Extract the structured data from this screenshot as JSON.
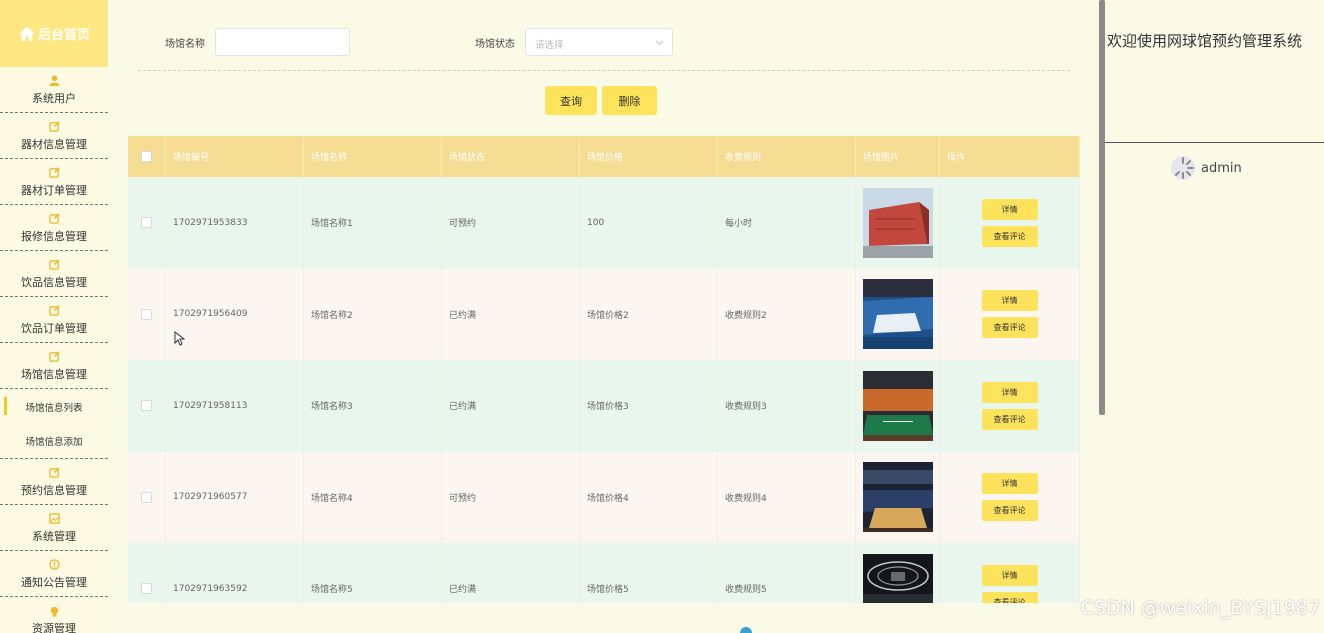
{
  "sidebar": {
    "home_label": "后台首页",
    "items": [
      {
        "label": "系统用户",
        "icon": "user-icon"
      },
      {
        "label": "器材信息管理",
        "icon": "edit-icon"
      },
      {
        "label": "器材订单管理",
        "icon": "edit-icon"
      },
      {
        "label": "报修信息管理",
        "icon": "edit-icon"
      },
      {
        "label": "饮品信息管理",
        "icon": "edit-icon"
      },
      {
        "label": "饮品订单管理",
        "icon": "edit-icon"
      },
      {
        "label": "场馆信息管理",
        "icon": "edit-icon"
      }
    ],
    "sub_items": [
      {
        "label": "场馆信息列表",
        "active": true
      },
      {
        "label": "场馆信息添加",
        "active": false
      }
    ],
    "items_after": [
      {
        "label": "预约信息管理",
        "icon": "edit-icon"
      },
      {
        "label": "系统管理",
        "icon": "picture-icon"
      },
      {
        "label": "通知公告管理",
        "icon": "alert-icon"
      },
      {
        "label": "资源管理",
        "icon": "bulb-icon"
      }
    ]
  },
  "search": {
    "name_label": "场馆名称",
    "name_value": "",
    "status_label": "场馆状态",
    "status_placeholder": "请选择",
    "query_button": "查询",
    "delete_button": "删除"
  },
  "table": {
    "headers": [
      "场馆编号",
      "场馆名称",
      "场馆状态",
      "场馆价格",
      "收费规则",
      "场馆图片",
      "操作"
    ],
    "rows": [
      {
        "id": "1702971953833",
        "name": "场馆名称1",
        "status": "可预约",
        "price": "100",
        "rule": "每小时"
      },
      {
        "id": "1702971956409",
        "name": "场馆名称2",
        "status": "已约满",
        "price": "场馆价格2",
        "rule": "收费规则2"
      },
      {
        "id": "1702971958113",
        "name": "场馆名称3",
        "status": "已约满",
        "price": "场馆价格3",
        "rule": "收费规则3"
      },
      {
        "id": "1702971960577",
        "name": "场馆名称4",
        "status": "可预约",
        "price": "场馆价格4",
        "rule": "收费规则4"
      },
      {
        "id": "1702971963592",
        "name": "场馆名称5",
        "status": "已约满",
        "price": "场馆价格5",
        "rule": "收费规则5"
      }
    ],
    "detail_button": "详情",
    "review_button": "查看评论"
  },
  "header": {
    "welcome": "欢迎使用网球馆预约管理系统",
    "username": "admin"
  },
  "watermark": "CSDN @weixin_BYSJ1987",
  "colors": {
    "accent": "#fde35c",
    "sidebar_bg": "#fcfae2",
    "header_bg": "#f4dc92",
    "row_even": "#e8f6ee",
    "row_odd": "#fbf7f0"
  }
}
